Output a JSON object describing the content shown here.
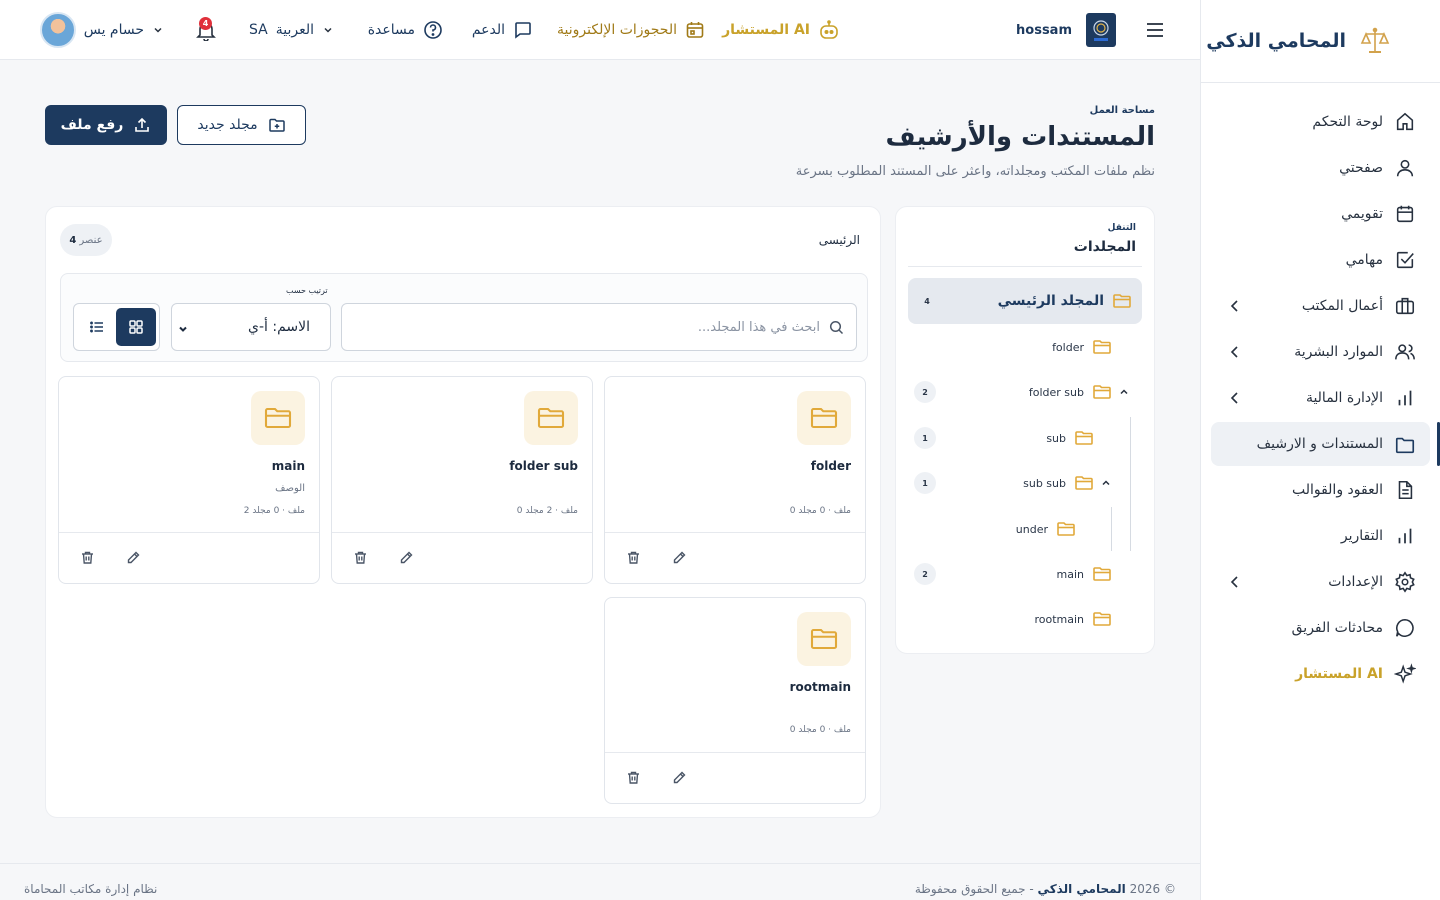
{
  "brand": {
    "title": "المحامي الذكي"
  },
  "sidebar": {
    "items": [
      {
        "label": "لوحة التحكم",
        "icon": "home-icon"
      },
      {
        "label": "صفحتي",
        "icon": "user-icon"
      },
      {
        "label": "تقويمي",
        "icon": "calendar-icon"
      },
      {
        "label": "مهامي",
        "icon": "check-square-icon"
      },
      {
        "label": "أعمال المكتب",
        "icon": "briefcase-icon",
        "has_children": true
      },
      {
        "label": "الموارد البشرية",
        "icon": "users-icon",
        "has_children": true
      },
      {
        "label": "الإدارة المالية",
        "icon": "bar-chart-icon",
        "has_children": true
      },
      {
        "label": "المستندات و الارشيف",
        "icon": "folder-icon",
        "active": true
      },
      {
        "label": "العقود والقوالب",
        "icon": "file-text-icon"
      },
      {
        "label": "التقارير",
        "icon": "bar-chart-icon"
      },
      {
        "label": "الإعدادات",
        "icon": "gear-icon",
        "has_children": true
      },
      {
        "label": "محادثات الفريق",
        "icon": "chat-icon"
      },
      {
        "label": "المستشار AI",
        "icon": "sparkle-icon"
      }
    ]
  },
  "topbar": {
    "username": "hossam",
    "ai_label": "المستشار AI",
    "bookings_label": "الحجوزات الإلكترونية",
    "support_label": "الدعم",
    "help_label": "مساعدة",
    "language_label": "العربية",
    "language_code": "SA",
    "notification_count": "4",
    "user_display_name": "حسام يس"
  },
  "page": {
    "breadcrumb": "مساحة العمل",
    "title": "المستندات والأرشيف",
    "subtitle": "نظم ملفات المكتب ومجلداته، واعثر على المستند المطلوب بسرعة",
    "upload_button": "رفع ملف",
    "new_folder_button": "مجلد جديد"
  },
  "tree": {
    "caption": "التنقل",
    "title": "المجلدات",
    "root": {
      "label": "المجلد الرئيسي",
      "count": "4"
    },
    "nodes": [
      {
        "label": "folder"
      },
      {
        "label": "folder sub",
        "count": "2"
      },
      {
        "label": "sub",
        "count": "1"
      },
      {
        "label": "sub sub",
        "count": "1"
      },
      {
        "label": "under"
      },
      {
        "label": "main",
        "count": "2"
      },
      {
        "label": "rootmain"
      }
    ]
  },
  "content": {
    "current_folder": "الرئيسى",
    "item_count": "4",
    "item_count_unit": "عنصر",
    "search_placeholder": "ابحث في هذا المجلد...",
    "sort_label": "ترتيب حسب",
    "sort_value": "الاسم: أ-ي",
    "cards": [
      {
        "name": "folder",
        "description": "",
        "meta": "0 ملف · 0 مجلد"
      },
      {
        "name": "folder sub",
        "description": "",
        "meta": "0 ملف · 2 مجلد"
      },
      {
        "name": "main",
        "description": "الوصف",
        "meta": "2 ملف · 0 مجلد"
      },
      {
        "name": "rootmain",
        "description": "",
        "meta": "0 ملف · 0 مجلد"
      }
    ]
  },
  "footer": {
    "left": "نظام إدارة مكاتب المحاماة",
    "copyright_prefix": "© 2026",
    "copyright_brand": "المحامي الذكي",
    "copyright_suffix": "- جميع الحقوق محفوظة"
  },
  "colors": {
    "primary": "#1d3a5f",
    "accent_gold": "#c9a22a",
    "folder_bg": "#fbf3e1",
    "danger": "#e0303b"
  }
}
